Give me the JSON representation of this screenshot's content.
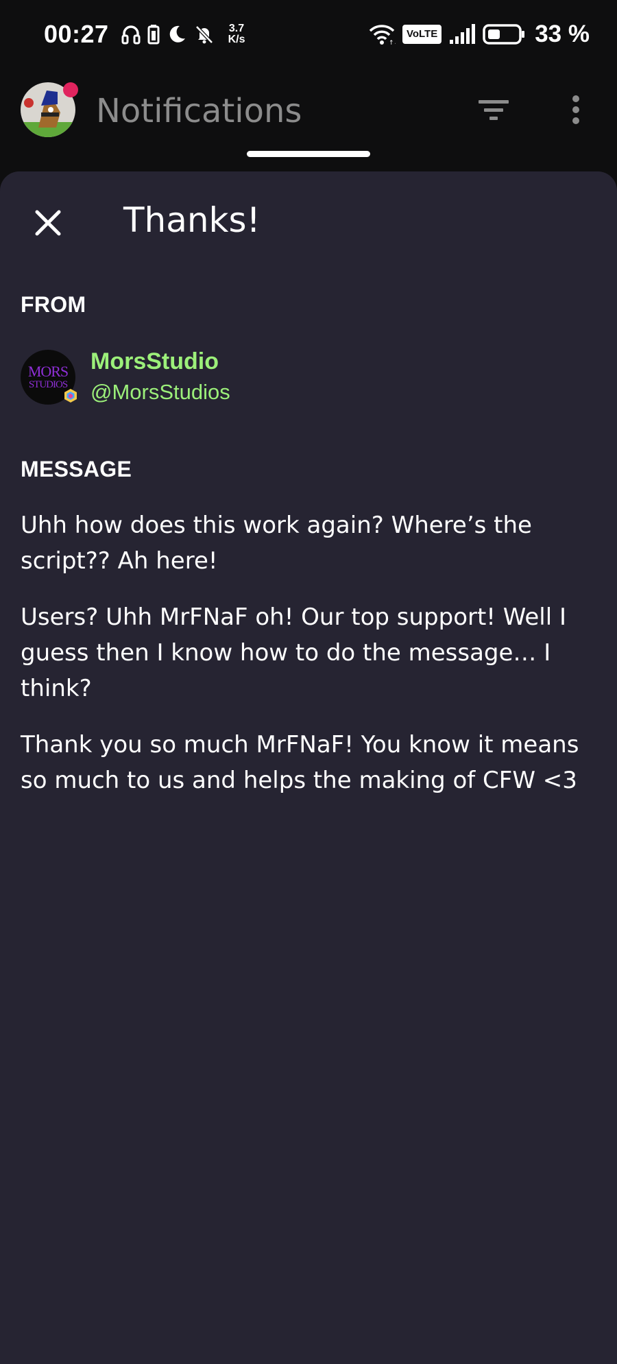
{
  "status_bar": {
    "time": "00:27",
    "net_speed_value": "3.7",
    "net_speed_unit": "K/s",
    "volte": "VoLTE",
    "battery": "33 %",
    "icons": [
      "headphones-icon",
      "battery-saver-icon",
      "moon-icon",
      "mute-bell-icon",
      "wifi-icon",
      "signal-icon",
      "battery-icon"
    ]
  },
  "app_bar": {
    "title": "Notifications",
    "icons": [
      "avatar",
      "filter-icon",
      "more-vert-icon"
    ]
  },
  "sheet": {
    "title": "Thanks!",
    "from_label": "FROM",
    "sender": {
      "name": "MorsStudio",
      "handle": "@MorsStudios",
      "avatar_text_line1": "MORS",
      "avatar_text_line2": "STUDIOS"
    },
    "message_label": "MESSAGE",
    "message_paragraphs": [
      "Uhh how does this work again? Where’s the script?? Ah here!",
      "Users? Uhh MrFNaF oh! Our top support! Well I guess then I know how to do the message… I think?",
      "Thank you so much MrFNaF! You know it means so much to us and helps the making of CFW <3"
    ]
  },
  "colors": {
    "background": "#0e0e0f",
    "sheet": "#262432",
    "accent_green": "#9cf07a",
    "muted_title": "#8c8c8c",
    "notification_dot": "#e0245e"
  }
}
